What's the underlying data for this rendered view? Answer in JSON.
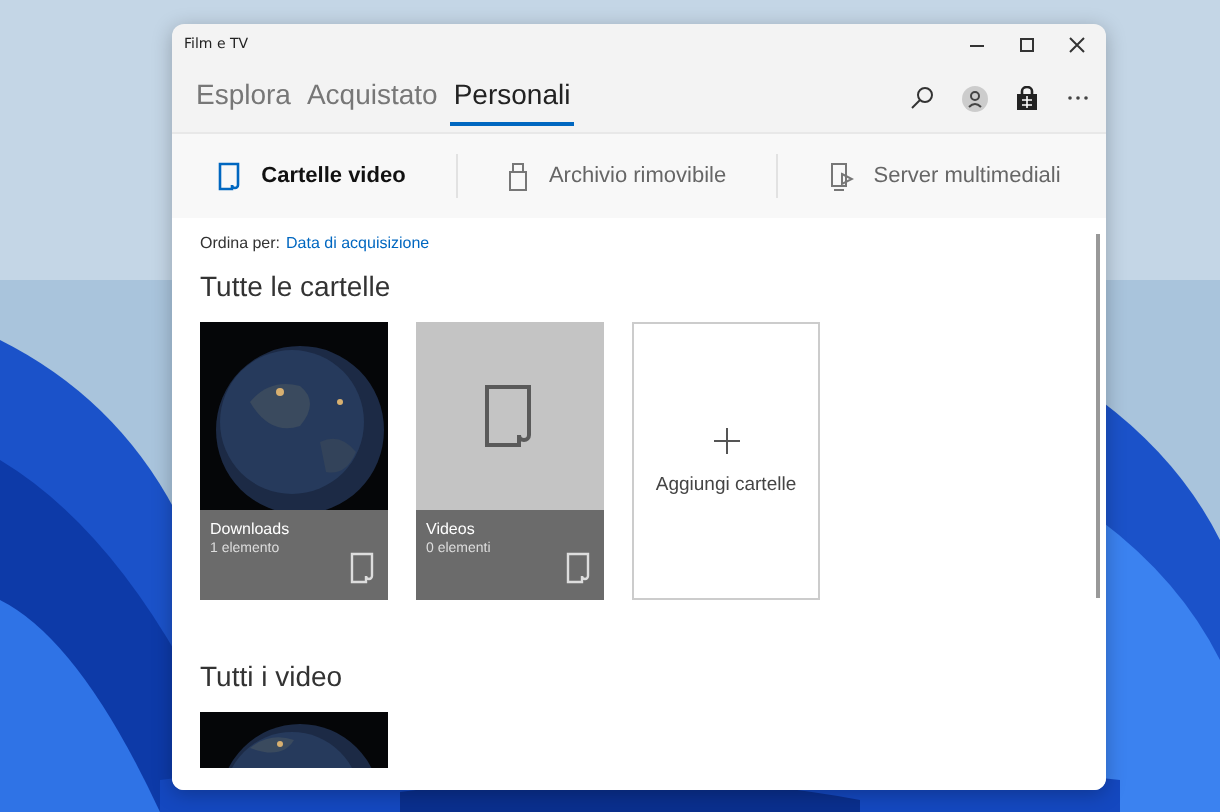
{
  "window": {
    "title": "Film e TV"
  },
  "tabs": [
    {
      "label": "Esplora",
      "selected": false
    },
    {
      "label": "Acquistato",
      "selected": false
    },
    {
      "label": "Personali",
      "selected": true
    }
  ],
  "sources": [
    {
      "label": "Cartelle video",
      "kind": "folder",
      "selected": true
    },
    {
      "label": "Archivio rimovibile",
      "kind": "drive",
      "selected": false
    },
    {
      "label": "Server multimediali",
      "kind": "server",
      "selected": false
    }
  ],
  "sort": {
    "label": "Ordina per:",
    "value": "Data di acquisizione"
  },
  "folders_section": {
    "title": "Tutte le cartelle",
    "items": [
      {
        "name": "Downloads",
        "count": "1 elemento"
      },
      {
        "kind": "empty",
        "name": "Videos",
        "count": "0 elementi"
      },
      {
        "kind": "add",
        "name": "Aggiungi cartelle"
      }
    ]
  },
  "videos_section": {
    "title": "Tutti i video"
  }
}
